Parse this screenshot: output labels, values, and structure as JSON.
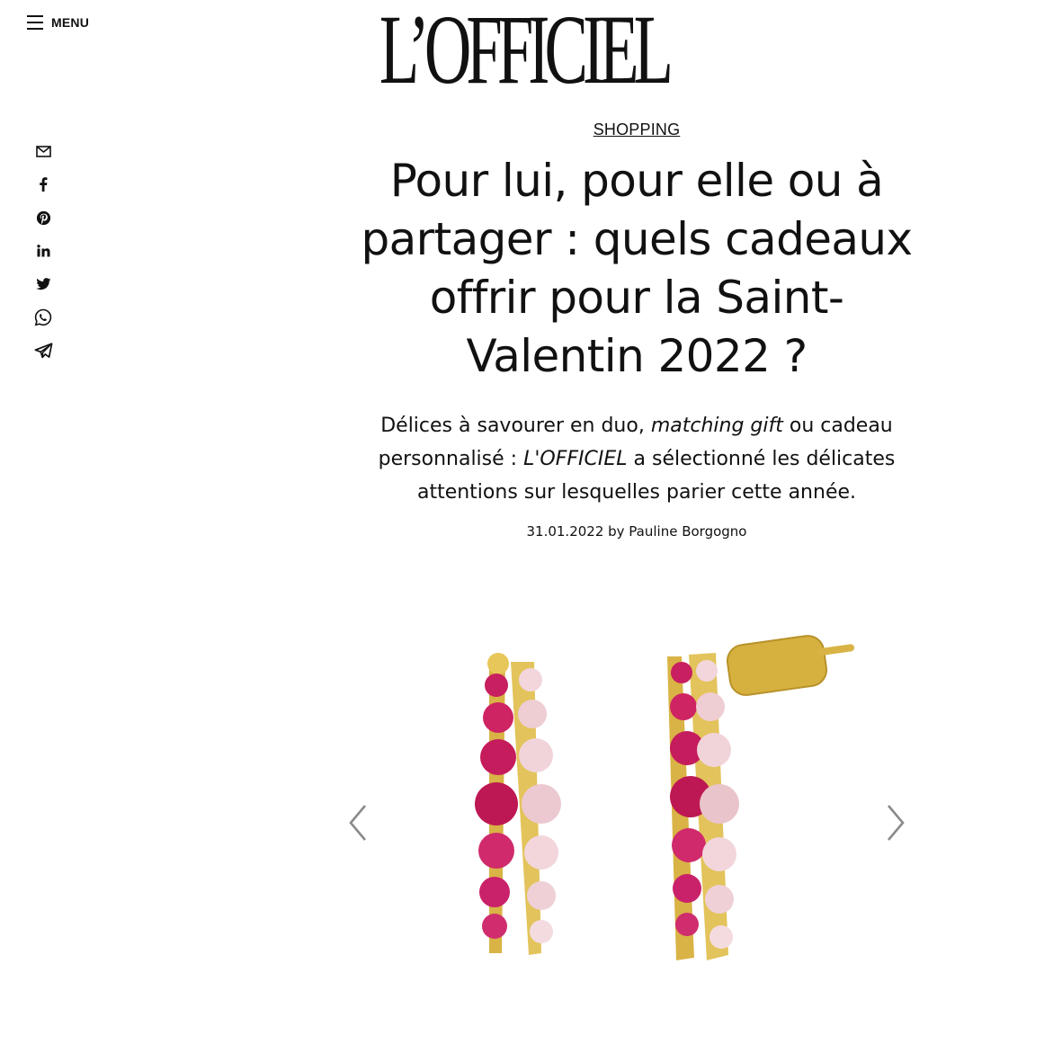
{
  "header": {
    "menu_label": "MENU",
    "logo_text": "L’OFFICIEL"
  },
  "share": {
    "icons": [
      "mail-icon",
      "facebook-icon",
      "pinterest-icon",
      "linkedin-icon",
      "twitter-icon",
      "whatsapp-icon",
      "telegram-icon"
    ]
  },
  "article": {
    "category": "SHOPPING",
    "title": "Pour lui, pour elle ou à partager : quels cadeaux offrir pour la Saint-Valentin 2022 ?",
    "standfirst": {
      "part1": "Délices à savourer en duo, ",
      "part2_italic": "matching gift",
      "part3": " ou cadeau personnalisé : ",
      "part4_italic": "L'OFFICIEL",
      "part5": " a sélectionné les délicates attentions sur lesquelles parier cette année."
    },
    "byline": "31.01.2022 by Pauline Borgogno"
  },
  "carousel": {
    "image_alt": "gold earrings set with pink and fuchsia stones",
    "prev_icon": "chevron-left-icon",
    "next_icon": "chevron-right-icon"
  },
  "colors": {
    "text": "#111111",
    "background": "#ffffff",
    "gold": "#d9b345",
    "ruby": "#cc1f63",
    "pink_stone": "#f1d2d8"
  }
}
